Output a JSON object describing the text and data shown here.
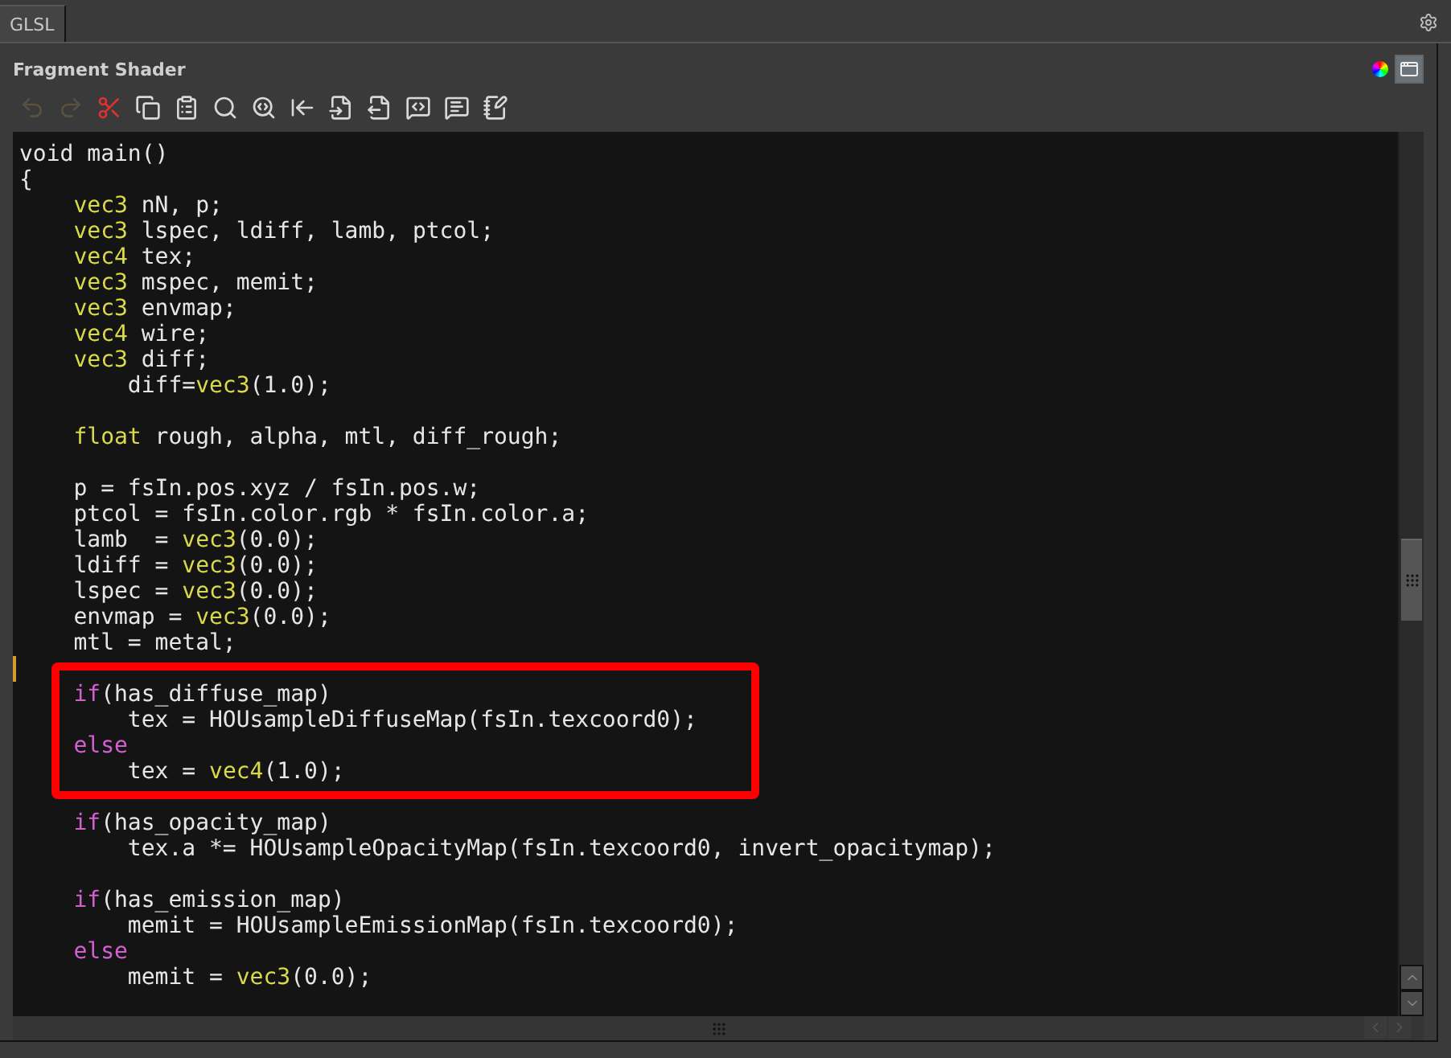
{
  "tabs": [
    {
      "label": "GLSL",
      "selected": true
    }
  ],
  "panel": {
    "title": "Fragment Shader"
  },
  "toolbar": [
    {
      "kind": "undo",
      "disabled": true
    },
    {
      "kind": "redo",
      "disabled": true
    },
    {
      "kind": "cut",
      "disabled": false
    },
    {
      "kind": "copy",
      "disabled": false
    },
    {
      "kind": "paste",
      "disabled": false
    },
    {
      "kind": "find",
      "disabled": false
    },
    {
      "kind": "replace",
      "disabled": false
    },
    {
      "kind": "unindent",
      "disabled": false
    },
    {
      "kind": "import",
      "disabled": false
    },
    {
      "kind": "export",
      "disabled": false
    },
    {
      "kind": "comment",
      "disabled": false
    },
    {
      "kind": "uncomment",
      "disabled": false
    },
    {
      "kind": "notes",
      "disabled": false
    }
  ],
  "code": [
    {
      "kind": "line",
      "segments": [
        {
          "kind": "plain",
          "text": "void main()"
        }
      ]
    },
    {
      "kind": "line",
      "segments": [
        {
          "kind": "plain",
          "text": "{"
        }
      ]
    },
    {
      "kind": "line",
      "segments": [
        {
          "kind": "type",
          "text": "    vec3"
        },
        {
          "kind": "plain",
          "text": " nN, p;"
        }
      ]
    },
    {
      "kind": "line",
      "segments": [
        {
          "kind": "type",
          "text": "    vec3"
        },
        {
          "kind": "plain",
          "text": " lspec, ldiff, lamb, ptcol;"
        }
      ]
    },
    {
      "kind": "line",
      "segments": [
        {
          "kind": "type",
          "text": "    vec4"
        },
        {
          "kind": "plain",
          "text": " tex;"
        }
      ]
    },
    {
      "kind": "line",
      "segments": [
        {
          "kind": "type",
          "text": "    vec3"
        },
        {
          "kind": "plain",
          "text": " mspec, memit;"
        }
      ]
    },
    {
      "kind": "line",
      "segments": [
        {
          "kind": "type",
          "text": "    vec3"
        },
        {
          "kind": "plain",
          "text": " envmap;"
        }
      ]
    },
    {
      "kind": "line",
      "segments": [
        {
          "kind": "type",
          "text": "    vec4"
        },
        {
          "kind": "plain",
          "text": " wire;"
        }
      ]
    },
    {
      "kind": "line",
      "segments": [
        {
          "kind": "type",
          "text": "    vec3"
        },
        {
          "kind": "plain",
          "text": " diff;"
        }
      ]
    },
    {
      "kind": "line",
      "segments": [
        {
          "kind": "plain",
          "text": "        diff="
        },
        {
          "kind": "type",
          "text": "vec3"
        },
        {
          "kind": "plain",
          "text": "(1.0);"
        }
      ]
    },
    {
      "kind": "blank"
    },
    {
      "kind": "line",
      "segments": [
        {
          "kind": "type",
          "text": "    float"
        },
        {
          "kind": "plain",
          "text": " rough, alpha, mtl, diff_rough;"
        }
      ]
    },
    {
      "kind": "blank"
    },
    {
      "kind": "line",
      "segments": [
        {
          "kind": "plain",
          "text": "    p = fsIn.pos.xyz / fsIn.pos.w;"
        }
      ]
    },
    {
      "kind": "line",
      "segments": [
        {
          "kind": "plain",
          "text": "    ptcol = fsIn.color.rgb * fsIn.color.a;"
        }
      ]
    },
    {
      "kind": "line",
      "segments": [
        {
          "kind": "plain",
          "text": "    lamb  = "
        },
        {
          "kind": "type",
          "text": "vec3"
        },
        {
          "kind": "plain",
          "text": "(0.0);"
        }
      ]
    },
    {
      "kind": "line",
      "segments": [
        {
          "kind": "plain",
          "text": "    ldiff = "
        },
        {
          "kind": "type",
          "text": "vec3"
        },
        {
          "kind": "plain",
          "text": "(0.0);"
        }
      ]
    },
    {
      "kind": "line",
      "segments": [
        {
          "kind": "plain",
          "text": "    lspec = "
        },
        {
          "kind": "type",
          "text": "vec3"
        },
        {
          "kind": "plain",
          "text": "(0.0);"
        }
      ]
    },
    {
      "kind": "line",
      "segments": [
        {
          "kind": "plain",
          "text": "    envmap = "
        },
        {
          "kind": "type",
          "text": "vec3"
        },
        {
          "kind": "plain",
          "text": "(0.0);"
        }
      ]
    },
    {
      "kind": "line",
      "segments": [
        {
          "kind": "plain",
          "text": "    mtl = metal;"
        }
      ]
    },
    {
      "kind": "caret"
    },
    {
      "kind": "highlight",
      "lines": [
        {
          "kind": "line",
          "segments": [
            {
              "kind": "keyword",
              "text": "    if"
            },
            {
              "kind": "plain",
              "text": "(has_diffuse_map)"
            }
          ]
        },
        {
          "kind": "line",
          "segments": [
            {
              "kind": "plain",
              "text": "        tex = HOUsampleDiffuseMap(fsIn.texcoord0);"
            }
          ]
        },
        {
          "kind": "line",
          "segments": [
            {
              "kind": "keyword",
              "text": "    else"
            }
          ]
        },
        {
          "kind": "line",
          "segments": [
            {
              "kind": "plain",
              "text": "        tex = "
            },
            {
              "kind": "type",
              "text": "vec4"
            },
            {
              "kind": "plain",
              "text": "(1.0);"
            }
          ]
        }
      ]
    },
    {
      "kind": "blank"
    },
    {
      "kind": "line",
      "segments": [
        {
          "kind": "keyword",
          "text": "    if"
        },
        {
          "kind": "plain",
          "text": "(has_opacity_map)"
        }
      ]
    },
    {
      "kind": "line",
      "segments": [
        {
          "kind": "plain",
          "text": "        tex.a *= HOUsampleOpacityMap(fsIn.texcoord0, invert_opacitymap);"
        }
      ]
    },
    {
      "kind": "blank"
    },
    {
      "kind": "line",
      "segments": [
        {
          "kind": "keyword",
          "text": "    if"
        },
        {
          "kind": "plain",
          "text": "(has_emission_map)"
        }
      ]
    },
    {
      "kind": "line",
      "segments": [
        {
          "kind": "plain",
          "text": "        memit = HOUsampleEmissionMap(fsIn.texcoord0);"
        }
      ]
    },
    {
      "kind": "line",
      "segments": [
        {
          "kind": "keyword",
          "text": "    else"
        }
      ]
    },
    {
      "kind": "line",
      "segments": [
        {
          "kind": "plain",
          "text": "        memit = "
        },
        {
          "kind": "type",
          "text": "vec3"
        },
        {
          "kind": "plain",
          "text": "(0.0);"
        }
      ]
    }
  ]
}
